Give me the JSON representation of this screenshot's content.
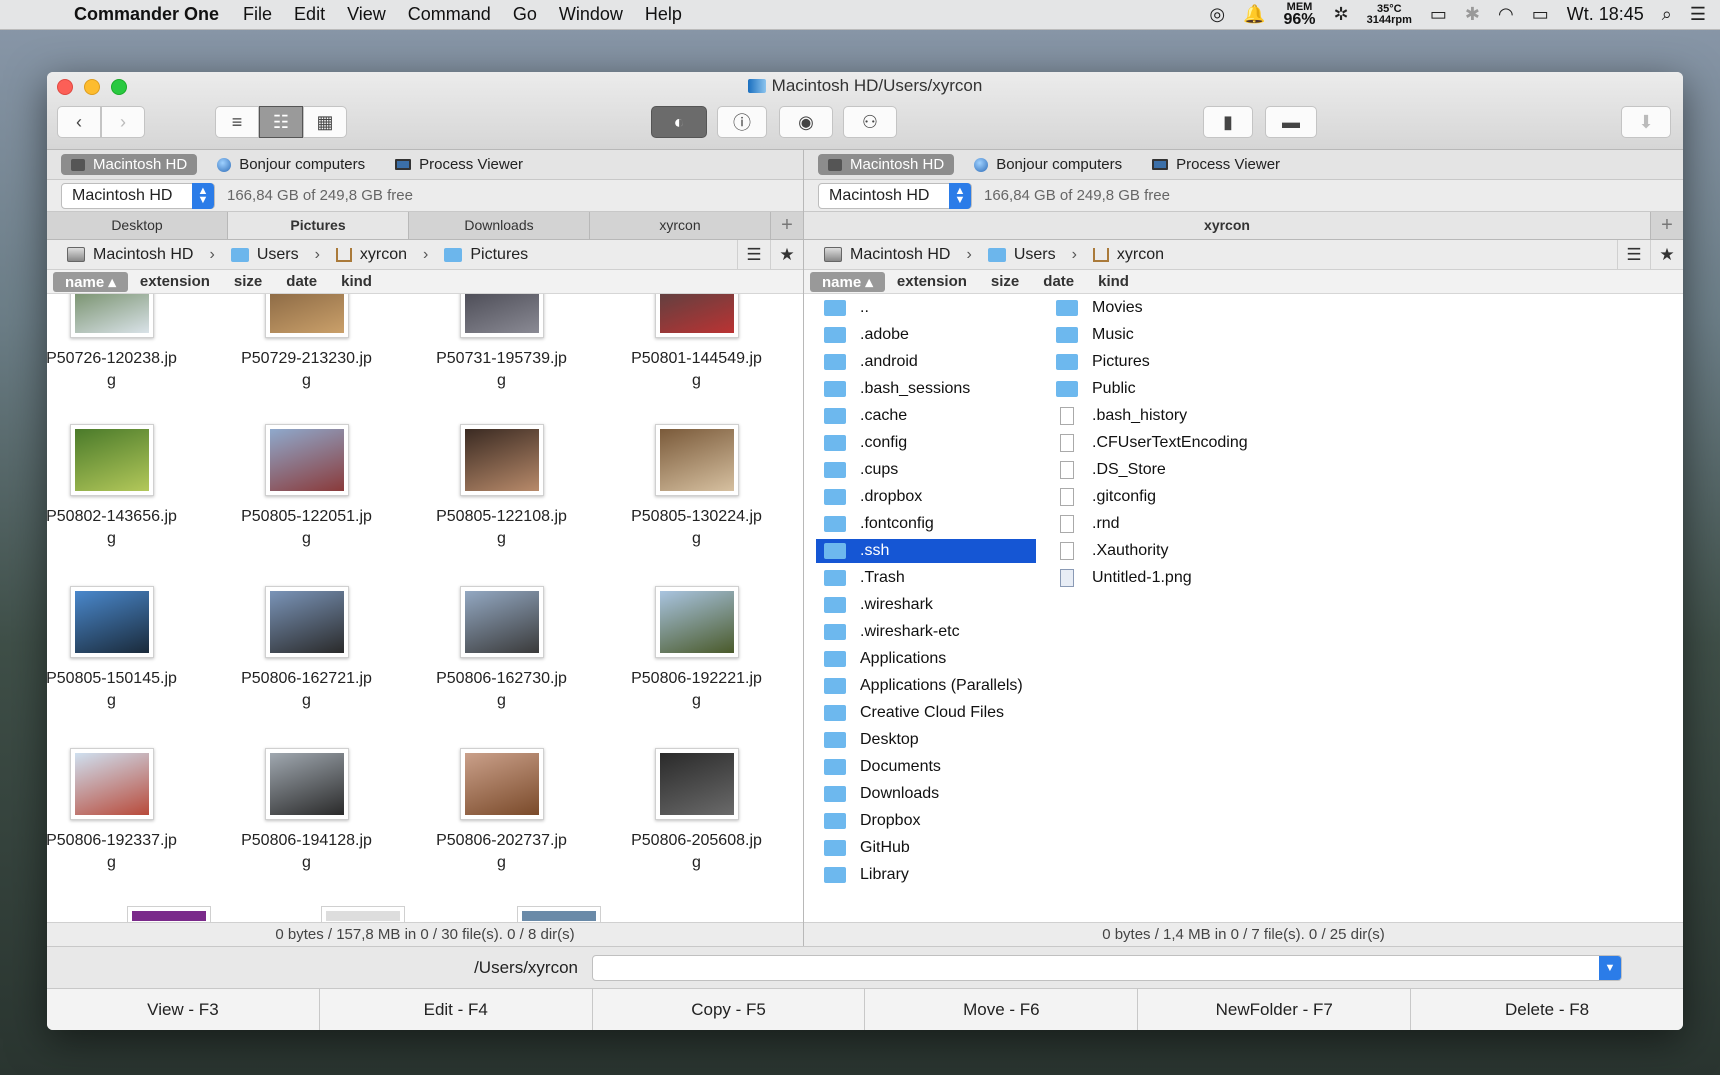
{
  "menubar": {
    "app_name": "Commander One",
    "items": [
      "File",
      "Edit",
      "View",
      "Command",
      "Go",
      "Window",
      "Help"
    ],
    "mem_label": "MEM",
    "mem_value": "96%",
    "temp": "35°C",
    "rpm": "3144rpm",
    "clock": "Wt. 18:45"
  },
  "window": {
    "title": "Macintosh HD/Users/xyrcon"
  },
  "left": {
    "devices": [
      "Macintosh HD",
      "Bonjour computers",
      "Process Viewer"
    ],
    "volume": "Macintosh HD",
    "free_space": "166,84 GB of 249,8 GB free",
    "tabs": [
      "Desktop",
      "Pictures",
      "Downloads",
      "xyrcon"
    ],
    "path": [
      "Macintosh HD",
      "Users",
      "xyrcon",
      "Pictures"
    ],
    "columns": [
      "name",
      "extension",
      "size",
      "date",
      "kind"
    ],
    "thumbs": [
      {
        "name": "P50726-120238.jpg",
        "line1": "P50726-120238.jp",
        "line2": "g",
        "c1": "#5c7a4a",
        "c2": "#d9e2e8"
      },
      {
        "name": "P50729-213230.jpg",
        "line1": "P50729-213230.jp",
        "line2": "g",
        "c1": "#7a5a3a",
        "c2": "#caa06a"
      },
      {
        "name": "P50731-195739.jpg",
        "line1": "P50731-195739.jp",
        "line2": "g",
        "c1": "#3a3a44",
        "c2": "#8a8a94"
      },
      {
        "name": "P50801-144549.jpg",
        "line1": "P50801-144549.jp",
        "line2": "g",
        "c1": "#444",
        "c2": "#b33"
      },
      {
        "name": "P50802-143656.jpg",
        "line1": "P50802-143656.jp",
        "line2": "g",
        "c1": "#4a7a2a",
        "c2": "#b3c85a"
      },
      {
        "name": "P50805-122051.jpg",
        "line1": "P50805-122051.jp",
        "line2": "g",
        "c1": "#8fa9cc",
        "c2": "#8a3a3a"
      },
      {
        "name": "P50805-122108.jpg",
        "line1": "P50805-122108.jp",
        "line2": "g",
        "c1": "#3a2a22",
        "c2": "#b88a6a"
      },
      {
        "name": "P50805-130224.jpg",
        "line1": "P50805-130224.jp",
        "line2": "g",
        "c1": "#7a5a3a",
        "c2": "#d6c0a0"
      },
      {
        "name": "P50805-150145.jpg",
        "line1": "P50805-150145.jp",
        "line2": "g",
        "c1": "#4a88cc",
        "c2": "#1a2a3a"
      },
      {
        "name": "P50806-162721.jpg",
        "line1": "P50806-162721.jp",
        "line2": "g",
        "c1": "#7a94b8",
        "c2": "#2a2a2a"
      },
      {
        "name": "P50806-162730.jpg",
        "line1": "P50806-162730.jp",
        "line2": "g",
        "c1": "#93a8c2",
        "c2": "#3a3a3a"
      },
      {
        "name": "P50806-192221.jpg",
        "line1": "P50806-192221.jp",
        "line2": "g",
        "c1": "#a9c4e0",
        "c2": "#4a5a2a"
      },
      {
        "name": "P50806-192337.jpg",
        "line1": "P50806-192337.jp",
        "line2": "g",
        "c1": "#cfe0f0",
        "c2": "#b84a3a"
      },
      {
        "name": "P50806-194128.jpg",
        "line1": "P50806-194128.jp",
        "line2": "g",
        "c1": "#a0a8b0",
        "c2": "#2a2a2a"
      },
      {
        "name": "P50806-202737.jpg",
        "line1": "P50806-202737.jp",
        "line2": "g",
        "c1": "#caa08a",
        "c2": "#7a4a2a"
      },
      {
        "name": "P50806-205608.jpg",
        "line1": "P50806-205608.jp",
        "line2": "g",
        "c1": "#2a2a2a",
        "c2": "#6a6a6a"
      }
    ],
    "status": "0 bytes / 157,8 MB in 0 / 30 file(s). 0 / 8 dir(s)"
  },
  "right": {
    "devices": [
      "Macintosh HD",
      "Bonjour computers",
      "Process Viewer"
    ],
    "volume": "Macintosh HD",
    "free_space": "166,84 GB of 249,8 GB free",
    "tab": "xyrcon",
    "path": [
      "Macintosh HD",
      "Users",
      "xyrcon"
    ],
    "columns": [
      "name",
      "extension",
      "size",
      "date",
      "kind"
    ],
    "col1": [
      "..",
      ".adobe",
      ".android",
      ".bash_sessions",
      ".cache",
      ".config",
      ".cups",
      ".dropbox",
      ".fontconfig",
      ".ssh",
      ".Trash",
      ".wireshark",
      ".wireshark-etc",
      "Applications",
      "Applications (Parallels)",
      "Creative Cloud Files",
      "Desktop",
      "Documents",
      "Downloads",
      "Dropbox",
      "GitHub",
      "Library"
    ],
    "col1_selected": ".ssh",
    "col2_folders": [
      "Movies",
      "Music",
      "Pictures",
      "Public"
    ],
    "col2_files": [
      ".bash_history",
      ".CFUserTextEncoding",
      ".DS_Store",
      ".gitconfig",
      ".rnd",
      ".Xauthority"
    ],
    "col2_png": "Untitled-1.png",
    "status": "0 bytes / 1,4 MB in 0 / 7 file(s). 0 / 25 dir(s)"
  },
  "command": {
    "cwd": "/Users/xyrcon",
    "input_value": ""
  },
  "fkeys": [
    "View - F3",
    "Edit - F4",
    "Copy - F5",
    "Move - F6",
    "NewFolder - F7",
    "Delete - F8"
  ],
  "colors": {
    "accent": "#2b7ce8",
    "selection": "#1556d4"
  }
}
